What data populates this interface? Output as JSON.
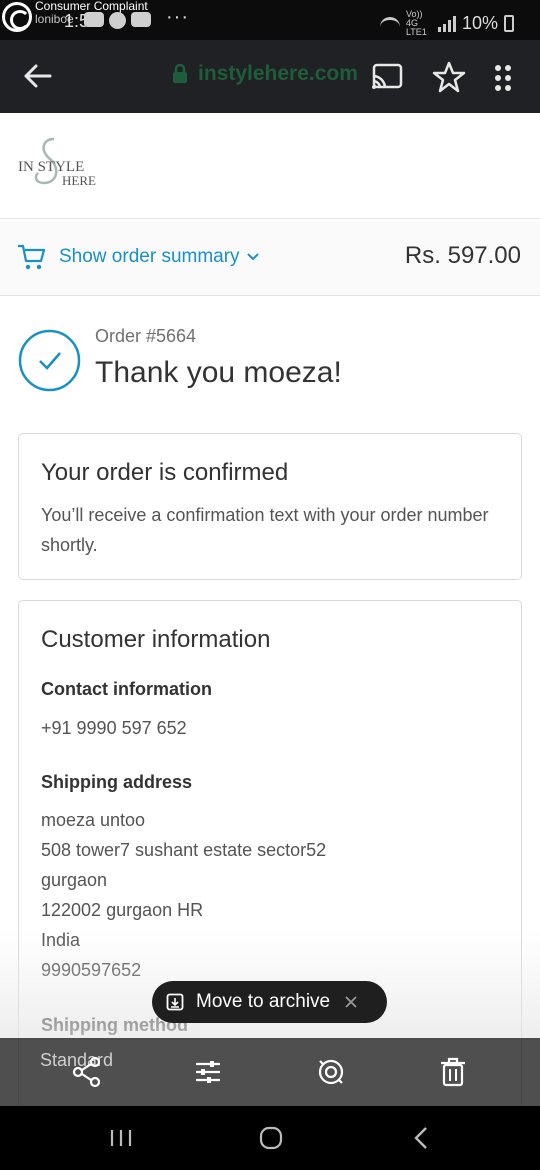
{
  "status_bar": {
    "watermark_line1": "Consumer Complaint",
    "watermark_line2": "loniboe",
    "time": "1:59",
    "more": "···",
    "network_label": "Vo)) 4G LTE1",
    "battery": "10%"
  },
  "browser": {
    "url": "instylehere.com"
  },
  "shop": {
    "logo_text_top": "IN STYLE",
    "logo_text_bottom": "HERE"
  },
  "summary": {
    "toggle_label": "Show order summary",
    "total": "Rs. 597.00"
  },
  "order": {
    "number": "Order #5664",
    "thanks": "Thank you moeza!"
  },
  "confirm_card": {
    "title": "Your order is confirmed",
    "message": "You’ll receive a confirmation text with your order number shortly."
  },
  "customer_card": {
    "title": "Customer information",
    "contact_heading": "Contact information",
    "contact_value": "+91 9990 597 652",
    "shipping_heading": "Shipping address",
    "address_lines": [
      "moeza untoo",
      "508 tower7 sushant estate sector52",
      "gurgaon",
      "122002 gurgaon HR",
      "India",
      "9990597652"
    ],
    "method_heading": "Shipping method",
    "method_value": "Standard"
  },
  "snackbar": {
    "label": "Move to archive"
  },
  "colors": {
    "accent": "#1990c6",
    "url_green": "#1e5d3a",
    "status_bg": "#0c0c0c",
    "toolbar_bg": "#202124"
  },
  "icons": {
    "back": "double-chevron-left-icon",
    "lock": "lock-icon",
    "cast": "cast-icon",
    "star": "star-add-icon",
    "more": "more-vert-icon",
    "cart": "cart-icon",
    "check": "check-circle-icon",
    "share": "share-icon",
    "edit": "sliders-icon",
    "lens": "lens-icon",
    "delete": "trash-icon"
  }
}
